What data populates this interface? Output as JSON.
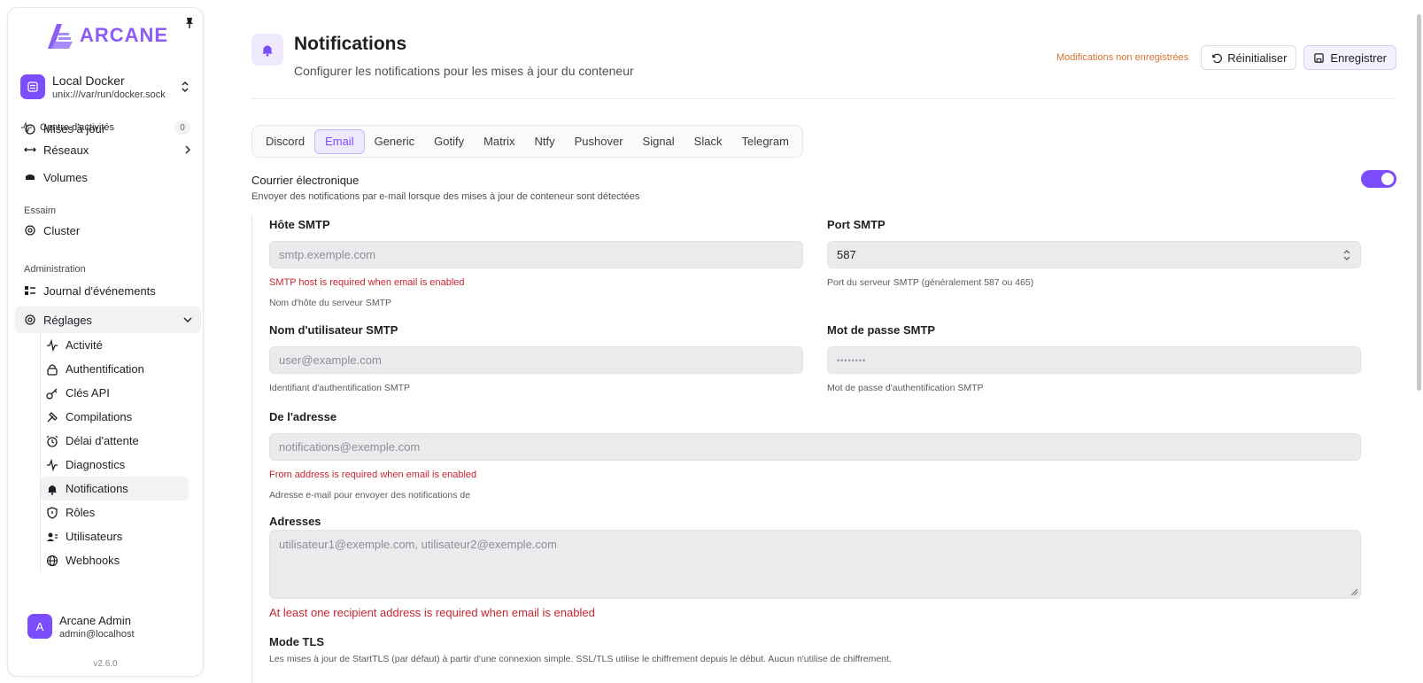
{
  "app": {
    "logo_text": "ARCANE",
    "version": "v2.6.0"
  },
  "environment": {
    "name": "Local Docker",
    "socket": "unix:///var/run/docker.sock"
  },
  "activity": {
    "label": "Centre d'activités",
    "count": "0"
  },
  "sidebar": {
    "partial_item": "Mises à jour",
    "items_top": [
      {
        "label": "Réseaux"
      },
      {
        "label": "Volumes"
      }
    ],
    "section_swarm": "Essaim",
    "swarm_items": [
      {
        "label": "Cluster"
      }
    ],
    "section_admin": "Administration",
    "admin_items": [
      {
        "label": "Journal d'événements"
      }
    ],
    "settings_label": "Réglages",
    "settings_items": [
      {
        "label": "Activité",
        "icon": "activity-icon"
      },
      {
        "label": "Authentification",
        "icon": "lock-icon"
      },
      {
        "label": "Clés API",
        "icon": "key-icon"
      },
      {
        "label": "Compilations",
        "icon": "hammer-icon"
      },
      {
        "label": "Délai d'attente",
        "icon": "alarm-icon"
      },
      {
        "label": "Diagnostics",
        "icon": "pulse-icon"
      },
      {
        "label": "Notifications",
        "icon": "bell-icon"
      },
      {
        "label": "Rôles",
        "icon": "shield-icon"
      },
      {
        "label": "Utilisateurs",
        "icon": "users-icon"
      },
      {
        "label": "Webhooks",
        "icon": "globe-icon"
      }
    ]
  },
  "user": {
    "initial": "A",
    "name": "Arcane Admin",
    "email": "admin@localhost"
  },
  "header": {
    "title": "Notifications",
    "subtitle": "Configurer les notifications pour les mises à jour du conteneur",
    "unsaved": "Modifications non enregistrées",
    "reset_label": "Réinitialiser",
    "save_label": "Enregistrer"
  },
  "tabs": [
    "Discord",
    "Email",
    "Generic",
    "Gotify",
    "Matrix",
    "Ntfy",
    "Pushover",
    "Signal",
    "Slack",
    "Telegram"
  ],
  "active_tab": "Email",
  "email": {
    "title": "Courrier électronique",
    "description": "Envoyer des notifications par e-mail lorsque des mises à jour de conteneur sont détectées",
    "enabled": true,
    "smtp_host": {
      "label": "Hôte SMTP",
      "placeholder": "smtp.exemple.com",
      "error": "SMTP host is required when email is enabled",
      "help": "Nom d'hôte du serveur SMTP"
    },
    "smtp_port": {
      "label": "Port SMTP",
      "value": "587",
      "help": "Port du serveur SMTP (généralement 587 ou 465)"
    },
    "smtp_user": {
      "label": "Nom d'utilisateur SMTP",
      "placeholder": "user@example.com",
      "help": "Identifiant d'authentification SMTP"
    },
    "smtp_password": {
      "label": "Mot de passe SMTP",
      "placeholder": "••••••••",
      "help": "Mot de passe d'authentification SMTP"
    },
    "from": {
      "label": "De l'adresse",
      "placeholder": "notifications@exemple.com",
      "error": "From address is required when email is enabled",
      "help": "Adresse e-mail pour envoyer des notifications de"
    },
    "addresses": {
      "label": "Adresses",
      "placeholder": "utilisateur1@exemple.com, utilisateur2@exemple.com",
      "error": "At least one recipient address is required when email is enabled"
    },
    "tls": {
      "label": "Mode TLS",
      "description": "Les mises à jour de StartTLS (par défaut) à partir d'une connexion simple. SSL/TLS utilise le chiffrement depuis le début. Aucun n'utilise de chiffrement."
    }
  },
  "colors": {
    "accent": "#7c4dff",
    "error": "#c8262f",
    "warning": "#d9722f"
  }
}
